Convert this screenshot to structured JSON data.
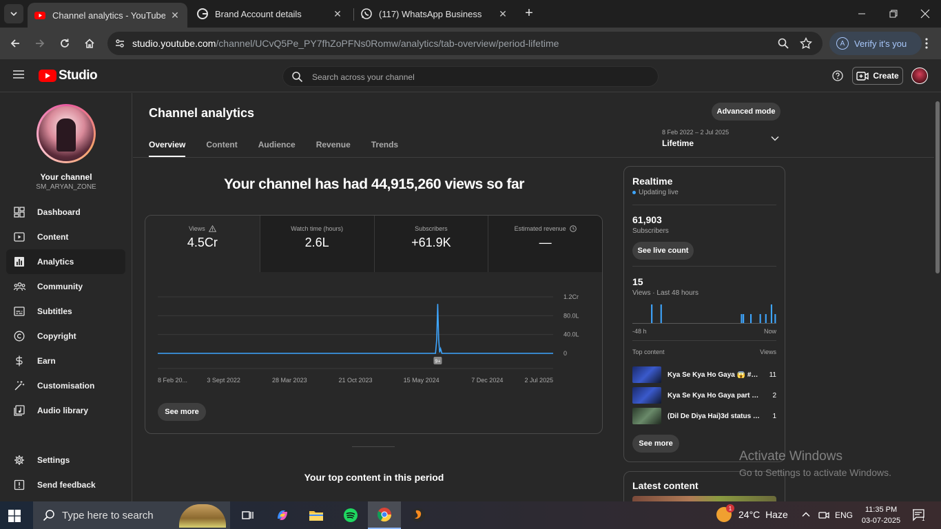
{
  "browser": {
    "tabs": [
      {
        "title": "Channel analytics - YouTube Studio",
        "favicon": "youtube-favicon",
        "active": true
      },
      {
        "title": "Brand Account details",
        "favicon": "google-favicon",
        "active": false
      },
      {
        "title": "(117) WhatsApp Business",
        "favicon": "whatsapp-favicon",
        "active": false
      }
    ],
    "url_host": "studio.youtube.com",
    "url_path": "/channel/UCvQ5Pe_PY7fhZoPFNs0Romw/analytics/tab-overview/period-lifetime",
    "verify_label": "Verify it's you",
    "verify_avatar": "A"
  },
  "studio": {
    "logo_text": "Studio",
    "search_placeholder": "Search across your channel",
    "create_label": "Create"
  },
  "sidebar": {
    "channel_label": "Your channel",
    "channel_handle": "SM_ARYAN_ZONE",
    "items": [
      {
        "label": "Dashboard",
        "icon": "dashboard-icon"
      },
      {
        "label": "Content",
        "icon": "content-icon"
      },
      {
        "label": "Analytics",
        "icon": "analytics-icon",
        "active": true
      },
      {
        "label": "Community",
        "icon": "community-icon"
      },
      {
        "label": "Subtitles",
        "icon": "subtitles-icon"
      },
      {
        "label": "Copyright",
        "icon": "copyright-icon"
      },
      {
        "label": "Earn",
        "icon": "earn-icon"
      },
      {
        "label": "Customisation",
        "icon": "customisation-icon"
      },
      {
        "label": "Audio library",
        "icon": "audio-library-icon"
      }
    ],
    "settings_label": "Settings",
    "feedback_label": "Send feedback"
  },
  "analytics": {
    "title": "Channel analytics",
    "advanced_mode_label": "Advanced mode",
    "tabs": [
      "Overview",
      "Content",
      "Audience",
      "Revenue",
      "Trends"
    ],
    "period_dates": "8 Feb 2022 – 2 Jul 2025",
    "period_label": "Lifetime",
    "headline": "Your channel has had 44,915,260 views so far",
    "metrics": [
      {
        "label": "Views",
        "value": "4.5Cr",
        "icon": "warning-icon"
      },
      {
        "label": "Watch time (hours)",
        "value": "2.6L"
      },
      {
        "label": "Subscribers",
        "value": "+61.9K"
      },
      {
        "label": "Estimated revenue",
        "value": "—",
        "icon": "clock-icon"
      }
    ],
    "see_more_label": "See more",
    "top_content_title": "Your top content in this period"
  },
  "chart_data": {
    "type": "line",
    "x_labels": [
      "8 Feb 20...",
      "3 Sept 2022",
      "28 Mar 2023",
      "21 Oct 2023",
      "15 May 2024",
      "7 Dec 2024",
      "2 Jul 2025"
    ],
    "y_ticks": [
      "1.2Cr",
      "80.0L",
      "40.0L",
      "0"
    ],
    "ylim": [
      0,
      12000000
    ],
    "series": [
      {
        "color": "#3ea6ff",
        "points": [
          [
            "2022-02-08",
            0
          ],
          [
            "2024-06-28",
            0
          ],
          [
            "2024-07-02",
            3000000
          ],
          [
            "2024-07-05",
            10500000
          ],
          [
            "2024-07-08",
            3000000
          ],
          [
            "2024-07-11",
            200000
          ],
          [
            "2024-07-14",
            1000000
          ],
          [
            "2024-07-18",
            0
          ],
          [
            "2025-07-02",
            0
          ]
        ]
      }
    ],
    "annotation_marker": "9+",
    "grid": true
  },
  "realtime": {
    "title": "Realtime",
    "status": "Updating live",
    "subscribers_value": "61,903",
    "subscribers_label": "Subscribers",
    "live_count_label": "See live count",
    "views_value": "15",
    "views_label": "Views · Last 48 hours",
    "bars": [
      0,
      0,
      0,
      0,
      0,
      0,
      0,
      0,
      0,
      0,
      2,
      0,
      0,
      0,
      0,
      2,
      0,
      0,
      0,
      0,
      0,
      0,
      0,
      0,
      0,
      0,
      0,
      0,
      0,
      0,
      0,
      0,
      0,
      0,
      0,
      0,
      0,
      0,
      0,
      0,
      0,
      0,
      0,
      0,
      0,
      0,
      0,
      0,
      0,
      0,
      0,
      0,
      0,
      0,
      0,
      0,
      0,
      0,
      1,
      1,
      0,
      0,
      0,
      1,
      0,
      0,
      0,
      0,
      1,
      0,
      0,
      1,
      0,
      0,
      2,
      0,
      1
    ],
    "axis_left": "-48 h",
    "axis_right": "Now",
    "top_content_header": "Top content",
    "top_content_views_header": "Views",
    "top_content": [
      {
        "title": "Kya Se Kya Ho Gaya 😱 #tre...",
        "views": "11"
      },
      {
        "title": "Kya Se Kya Ho Gaya part 2😱...",
        "views": "2"
      },
      {
        "title": "(Dil De Diya Hai)3d status | w...",
        "views": "1"
      }
    ],
    "see_more_label": "See more"
  },
  "latest": {
    "title": "Latest content"
  },
  "watermark": {
    "line1": "Activate Windows",
    "line2": "Go to Settings to activate Windows."
  },
  "taskbar": {
    "search_text": "Type here to search",
    "weather_temp": "24°C",
    "weather_desc": "Haze",
    "weather_badge": "1",
    "language": "ENG",
    "time": "11:35 PM",
    "date": "03-07-2025",
    "notification_count": "1"
  }
}
